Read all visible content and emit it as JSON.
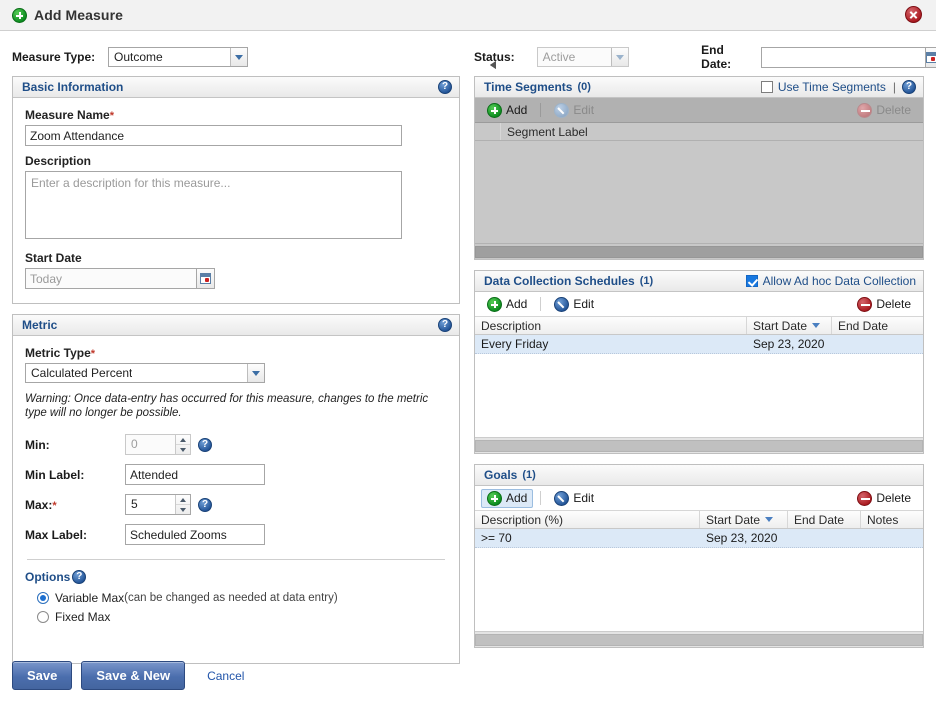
{
  "window": {
    "title": "Add Measure",
    "add_icon": "plus-circle-icon",
    "close_icon": "close-icon"
  },
  "form": {
    "measure_type": {
      "label": "Measure Type:",
      "value": "Outcome"
    },
    "status": {
      "label": "Status:",
      "value": "Active",
      "disabled": true
    },
    "end_date": {
      "label": "End Date:",
      "value": "",
      "calendar_icon": "calendar-icon"
    }
  },
  "basic_information": {
    "title": "Basic Information",
    "help_icon": "help-icon",
    "measure_name": {
      "label": "Measure Name",
      "required": "*",
      "value": "Zoom Attendance"
    },
    "description": {
      "label": "Description",
      "value": "",
      "placeholder": "Enter a description for this measure..."
    },
    "start_date": {
      "label": "Start Date",
      "value": "",
      "placeholder": "Today",
      "calendar_icon": "calendar-icon"
    }
  },
  "metric": {
    "title": "Metric",
    "help_icon": "help-icon",
    "metric_type": {
      "label": "Metric Type",
      "required": "*",
      "value": "Calculated Percent"
    },
    "warning": "Warning: Once data-entry has occurred for this measure, changes to the metric type will no longer be possible.",
    "min": {
      "label": "Min:",
      "value": "0",
      "disabled": true
    },
    "min_label": {
      "label": "Min Label:",
      "value": "Attended"
    },
    "max": {
      "label": "Max:",
      "required": "*",
      "value": "5"
    },
    "max_label": {
      "label": "Max Label:",
      "value": "Scheduled Zooms"
    },
    "options": {
      "title": "Options",
      "help_icon": "help-icon",
      "items": [
        {
          "label": "Variable Max",
          "hint": "(can be changed as needed at data entry)",
          "selected": true
        },
        {
          "label": "Fixed Max",
          "hint": "",
          "selected": false
        }
      ]
    }
  },
  "time_segments": {
    "title": "Time Segments",
    "count": "(0)",
    "use_checkbox": {
      "label": "Use Time Segments",
      "checked": false
    },
    "help_icon": "help-icon",
    "toolbar": {
      "add": "Add",
      "add_icon": "add-circle-icon",
      "edit": "Edit",
      "edit_icon": "edit-pencil-icon",
      "delete": "Delete",
      "delete_icon": "delete-circle-icon"
    },
    "columns": [
      "",
      "Segment Label"
    ],
    "rows": []
  },
  "data_collection_schedules": {
    "title": "Data Collection Schedules",
    "count": "(1)",
    "adhoc_checkbox": {
      "label": "Allow Ad hoc Data Collection",
      "checked": true
    },
    "toolbar": {
      "add": "Add",
      "add_icon": "add-circle-icon",
      "edit": "Edit",
      "edit_icon": "edit-pencil-icon",
      "delete": "Delete",
      "delete_icon": "delete-circle-icon"
    },
    "columns": [
      "Description",
      "Start Date",
      "End Date"
    ],
    "sorted_column": "Start Date",
    "rows": [
      {
        "description": "Every Friday",
        "start_date": "Sep 23, 2020",
        "end_date": ""
      }
    ]
  },
  "goals": {
    "title": "Goals",
    "count": "(1)",
    "toolbar": {
      "add": "Add",
      "add_icon": "add-circle-icon",
      "edit": "Edit",
      "edit_icon": "edit-pencil-icon",
      "delete": "Delete",
      "delete_icon": "delete-circle-icon"
    },
    "columns": [
      "Description (%)",
      "Start Date",
      "End Date",
      "Notes"
    ],
    "sorted_column": "Start Date",
    "rows": [
      {
        "description": ">= 70",
        "start_date": "Sep 23, 2020",
        "end_date": "",
        "notes": ""
      }
    ]
  },
  "footer": {
    "save": "Save",
    "save_and_new": "Save & New",
    "cancel": "Cancel"
  },
  "colors": {
    "accent_blue": "#1f4e88",
    "button_blue": "#4b6ead",
    "row_select": "#dce9f7",
    "add_green": "#0a8a1e",
    "delete_red": "#a8161c"
  }
}
